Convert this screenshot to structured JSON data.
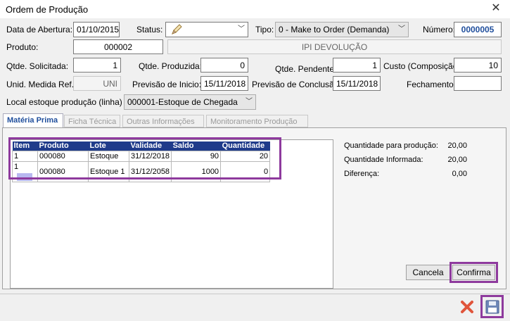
{
  "window": {
    "title": "Ordem de Produção",
    "close": "✕"
  },
  "header": {
    "data_abertura_label": "Data de Abertura:",
    "data_abertura": "01/10/2015",
    "status_label": "Status:",
    "tipo_label": "Tipo:",
    "tipo": "0 - Make to Order (Demanda)",
    "numero_label": "Número:",
    "numero": "0000005",
    "produto_label": "Produto:",
    "produto_codigo": "000002",
    "produto_descricao": "IPI DEVOLUÇÃO",
    "qtde_solicitada_label": "Qtde. Solicitada:",
    "qtde_solicitada": "1",
    "qtde_produzida_label": "Qtde. Produzida:",
    "qtde_produzida": "0",
    "qtde_pendente_label": "Qtde. Pendente:",
    "qtde_pendente": "1",
    "custo_label": "Custo (Composição):",
    "custo": "10",
    "unid_label": "Unid. Medida Ref.",
    "unid": "UNI",
    "previsao_inicio_label": "Previsão de Inicio:",
    "previsao_inicio": "15/11/2018",
    "previsao_conclusao_label": "Previsão de Conclusão:",
    "previsao_conclusao": "15/11/2018",
    "fechamento_label": "Fechamento:",
    "fechamento": "",
    "local_label": "Local estoque produção (linha) :",
    "local": "000001-Estoque de Chegada"
  },
  "tabs": [
    "Matéria Prima",
    "Ficha Técnica",
    "Outras Informações",
    "Monitoramento Produção"
  ],
  "table": {
    "headers": [
      "Item",
      "Produto",
      "Lote",
      "Validade",
      "Saldo",
      "Quantidade"
    ],
    "rows": [
      [
        "1",
        "000080",
        "Estoque",
        "31/12/2018",
        "90",
        "20"
      ],
      [
        "1",
        "000080",
        "Estoque 1",
        "31/12/2058",
        "1000",
        "0"
      ]
    ]
  },
  "summary": {
    "qtd_producao_label": "Quantidade para produção:",
    "qtd_producao": "20,00",
    "qtd_informada_label": "Quantidade Informada:",
    "qtd_informada": "20,00",
    "diferenca_label": "Diferença:",
    "diferenca": "0,00"
  },
  "buttons": {
    "cancela": "Cancela",
    "confirma": "Confirma"
  },
  "colors": {
    "highlight": "#8e3a9d",
    "header_blue": "#1f3b8a",
    "numero_blue": "#1f4e9c"
  },
  "icons": {
    "status": "pencil-icon",
    "cancel": "red-x-icon",
    "save": "floppy-disk-icon"
  }
}
